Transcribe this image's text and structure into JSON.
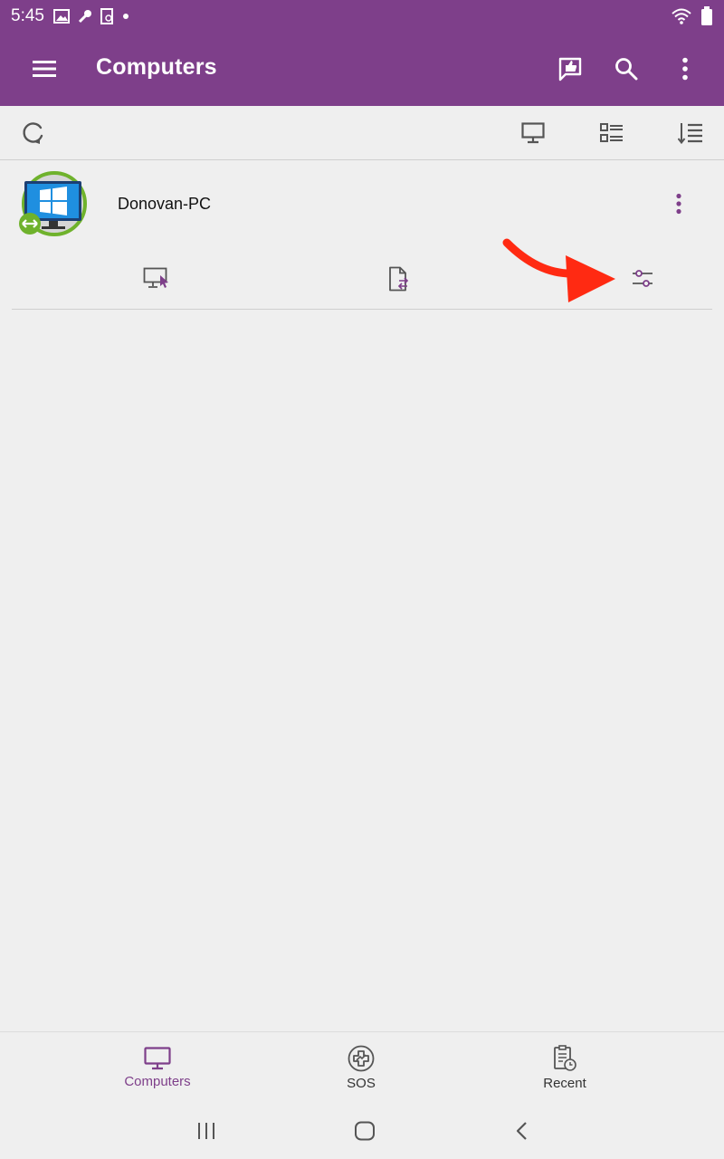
{
  "status_bar": {
    "time": "5:45"
  },
  "app_bar": {
    "title": "Computers"
  },
  "computer": {
    "name": "Donovan-PC"
  },
  "bottom_nav": {
    "items": [
      {
        "label": "Computers",
        "active": true
      },
      {
        "label": "SOS",
        "active": false
      },
      {
        "label": "Recent",
        "active": false
      }
    ]
  },
  "colors": {
    "brand": "#7e3f8a",
    "annotation_arrow": "#ff2a12",
    "avatar_ring": "#6fb22c",
    "windows_blue": "#1f8fe0"
  },
  "icons": [
    "menu-icon",
    "feedback-icon",
    "search-icon",
    "more-vert-icon",
    "refresh-icon",
    "monitor-icon",
    "list-view-icon",
    "sort-icon",
    "remote-control-icon",
    "file-transfer-icon",
    "settings-sliders-icon",
    "sos-icon",
    "recent-icon"
  ]
}
